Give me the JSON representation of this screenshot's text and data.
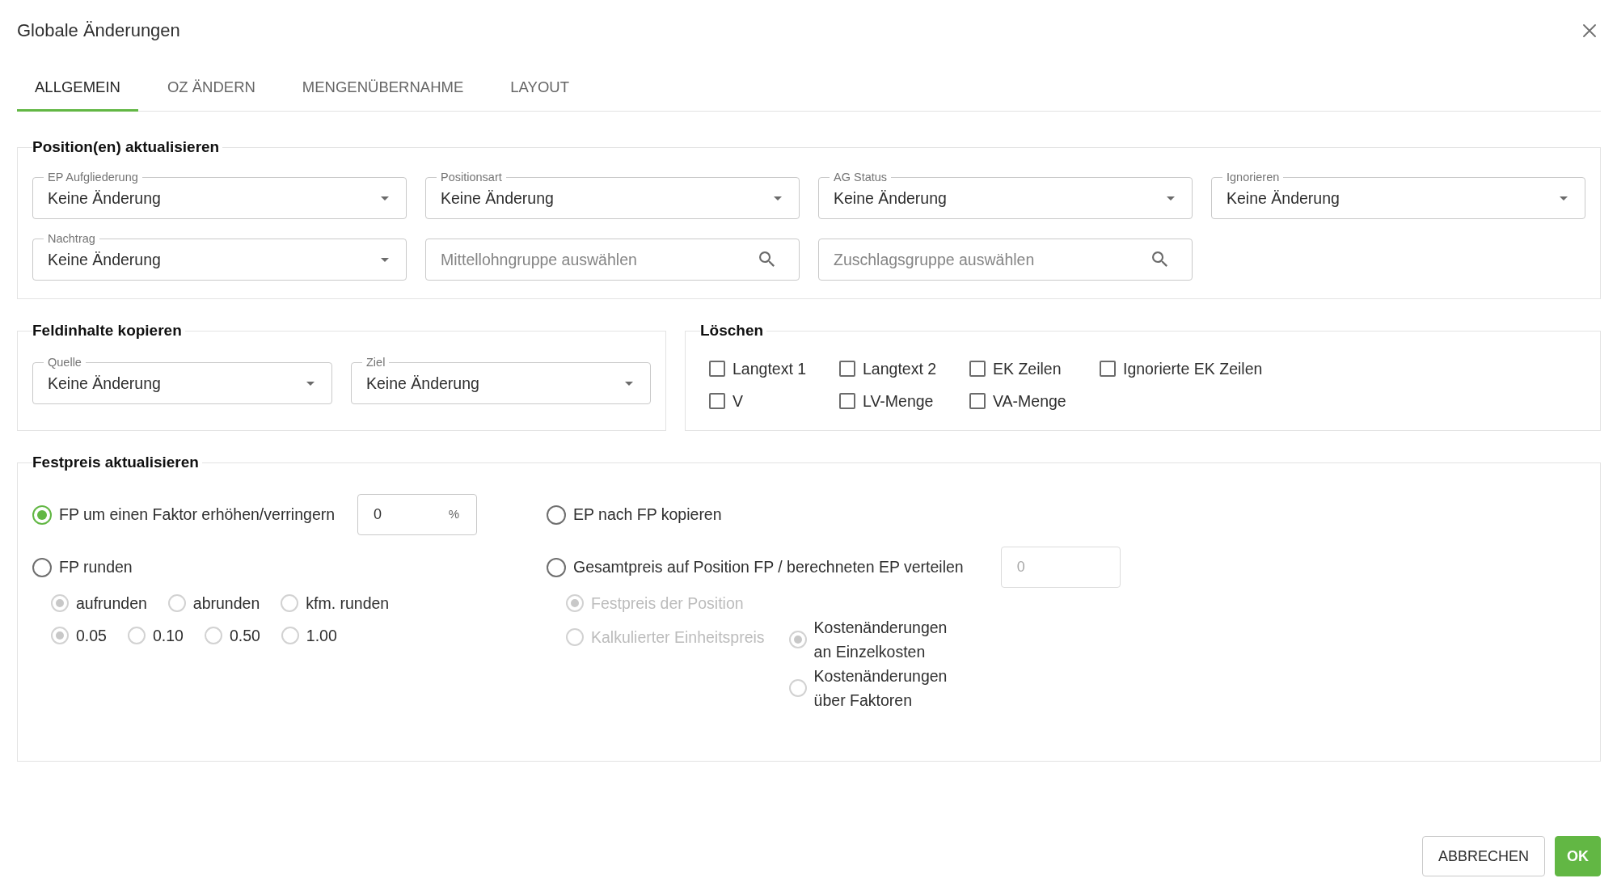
{
  "dialog": {
    "title": "Globale Änderungen"
  },
  "tabs": [
    {
      "label": "ALLGEMEIN",
      "selected": true
    },
    {
      "label": "OZ ÄNDERN",
      "selected": false
    },
    {
      "label": "MENGENÜBERNAHME",
      "selected": false
    },
    {
      "label": "LAYOUT",
      "selected": false
    }
  ],
  "position_update": {
    "legend": "Position(en) aktualisieren",
    "fields": [
      {
        "kind": "select",
        "label": "EP Aufgliederung",
        "value": "Keine Änderung"
      },
      {
        "kind": "select",
        "label": "Positionsart",
        "value": "Keine Änderung"
      },
      {
        "kind": "select",
        "label": "AG Status",
        "value": "Keine Änderung"
      },
      {
        "kind": "select",
        "label": "Ignorieren",
        "value": "Keine Änderung"
      },
      {
        "kind": "select",
        "label": "Nachtrag",
        "value": "Keine Änderung"
      },
      {
        "kind": "search",
        "placeholder": "Mittellohngruppe auswählen"
      },
      {
        "kind": "search",
        "placeholder": "Zuschlagsgruppe auswählen"
      }
    ]
  },
  "copy_fields": {
    "legend": "Feldinhalte kopieren",
    "fields": [
      {
        "kind": "select",
        "label": "Quelle",
        "value": "Keine Änderung"
      },
      {
        "kind": "select",
        "label": "Ziel",
        "value": "Keine Änderung"
      }
    ]
  },
  "delete": {
    "legend": "Löschen",
    "checkboxes": [
      {
        "label": "Langtext 1",
        "checked": false
      },
      {
        "label": "Langtext 2",
        "checked": false
      },
      {
        "label": "EK Zeilen",
        "checked": false
      },
      {
        "label": "Ignorierte EK Zeilen",
        "checked": false
      },
      {
        "label": "V",
        "checked": false
      },
      {
        "label": "LV-Menge",
        "checked": false
      },
      {
        "label": "VA-Menge",
        "checked": false
      }
    ]
  },
  "fixed_price": {
    "legend": "Festpreis aktualisieren",
    "options": [
      {
        "kind": "factor",
        "label": "FP um einen Faktor erhöhen/verringern",
        "selected": true,
        "input": {
          "value": "0",
          "unit": "%",
          "disabled": false
        }
      },
      {
        "kind": "copy",
        "label": "EP nach FP kopieren",
        "selected": false
      },
      {
        "kind": "round",
        "label": "FP runden",
        "selected": false,
        "groups": [
          {
            "options": [
              {
                "label": "aufrunden",
                "selected": true,
                "disabled": true
              },
              {
                "label": "abrunden",
                "selected": false,
                "disabled": true
              },
              {
                "label": "kfm. runden",
                "selected": false,
                "disabled": true
              }
            ]
          },
          {
            "options": [
              {
                "label": "0.05",
                "selected": true,
                "disabled": true
              },
              {
                "label": "0.10",
                "selected": false,
                "disabled": true
              },
              {
                "label": "0.50",
                "selected": false,
                "disabled": true
              },
              {
                "label": "1.00",
                "selected": false,
                "disabled": true
              }
            ]
          }
        ]
      },
      {
        "kind": "distribute",
        "label": "Gesamtpreis auf Position FP / berechneten EP verteilen",
        "selected": false,
        "input": {
          "placeholder": "0",
          "disabled": true
        },
        "sub_options": [
          {
            "label": "Festpreis der Position",
            "selected": true,
            "disabled": true,
            "label_dimmed": true
          },
          {
            "label": "Kalkulierter Einheitspreis",
            "selected": false,
            "disabled": true,
            "label_dimmed": true,
            "children": [
              {
                "label": "Kostenänderungen an Einzelkosten",
                "selected": true,
                "disabled": true,
                "label_dimmed": false
              },
              {
                "label": "Kostenänderungen über Faktoren",
                "selected": false,
                "disabled": true,
                "label_dimmed": false
              }
            ]
          }
        ]
      }
    ]
  },
  "buttons": [
    {
      "kind": "secondary",
      "label": "ABBRECHEN"
    },
    {
      "kind": "primary",
      "label": "OK"
    }
  ]
}
